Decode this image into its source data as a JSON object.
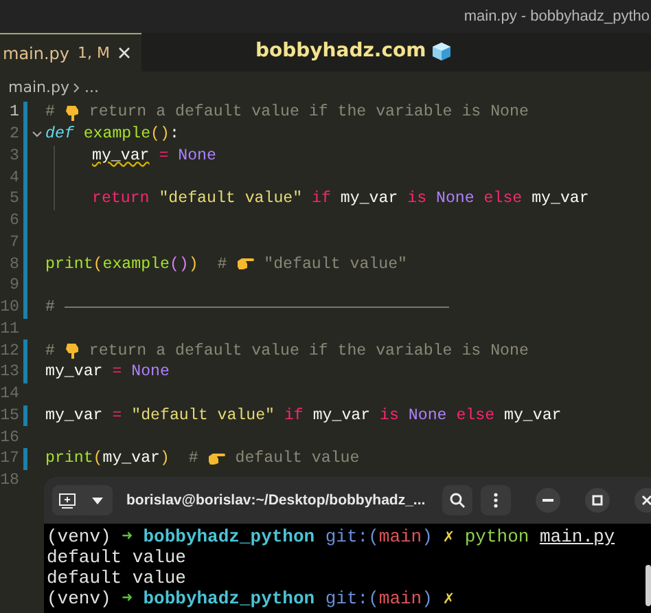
{
  "window": {
    "title": "main.py - bobbyhadz_pytho"
  },
  "tabs": [
    {
      "label": "main.py",
      "status": "1, M",
      "selected": true
    }
  ],
  "banner": {
    "text": "bobbyhadz.com"
  },
  "breadcrumb": {
    "file": "main.py",
    "rest": "..."
  },
  "editor": {
    "lines": [
      {
        "number": "1",
        "current": true,
        "modified": true,
        "tokens": [
          {
            "kind": "comment",
            "text": "# "
          },
          {
            "kind": "hand-down"
          },
          {
            "kind": "comment",
            "text": " return a default value if the variable is None"
          }
        ]
      },
      {
        "number": "2",
        "current": false,
        "modified": true,
        "foldable": true,
        "tokens": [
          {
            "kind": "storage",
            "text": "def "
          },
          {
            "kind": "func",
            "text": "example"
          },
          {
            "kind": "paren",
            "text": "()"
          },
          {
            "kind": "plain",
            "text": ":"
          }
        ]
      },
      {
        "number": "3",
        "current": false,
        "modified": true,
        "indented": true,
        "tokens": [
          {
            "kind": "plain",
            "text": "my_var",
            "warning": true
          },
          {
            "kind": "keyword",
            "text": " = "
          },
          {
            "kind": "constant",
            "text": "None"
          }
        ]
      },
      {
        "number": "4",
        "current": false,
        "modified": true,
        "indented": true
      },
      {
        "number": "5",
        "current": false,
        "modified": true,
        "indented": true,
        "tokens": [
          {
            "kind": "keyword",
            "text": "return "
          },
          {
            "kind": "string",
            "text": "\"default value\" "
          },
          {
            "kind": "keyword",
            "text": "if "
          },
          {
            "kind": "plain",
            "text": "my_var "
          },
          {
            "kind": "keyword",
            "text": "is "
          },
          {
            "kind": "constant",
            "text": "None "
          },
          {
            "kind": "keyword",
            "text": "else "
          },
          {
            "kind": "plain",
            "text": "my_var"
          }
        ]
      },
      {
        "number": "6",
        "current": false,
        "modified": true
      },
      {
        "number": "7",
        "current": false,
        "modified": true
      },
      {
        "number": "8",
        "current": false,
        "modified": true,
        "tokens": [
          {
            "kind": "func",
            "text": "print"
          },
          {
            "kind": "paren",
            "text": "("
          },
          {
            "kind": "func",
            "text": "example"
          },
          {
            "kind": "paren2",
            "text": "()"
          },
          {
            "kind": "paren",
            "text": ")  "
          },
          {
            "kind": "comment",
            "text": "# "
          },
          {
            "kind": "hand-right"
          },
          {
            "kind": "comment",
            "text": " \"default value\""
          }
        ]
      },
      {
        "number": "9",
        "current": false,
        "modified": true
      },
      {
        "number": "10",
        "current": false,
        "modified": true,
        "tokens": [
          {
            "kind": "comment",
            "text": "# "
          },
          {
            "kind": "rule"
          }
        ]
      },
      {
        "number": "11",
        "current": false,
        "modified": false
      },
      {
        "number": "12",
        "current": false,
        "modified": true,
        "tokens": [
          {
            "kind": "comment",
            "text": "# "
          },
          {
            "kind": "hand-down"
          },
          {
            "kind": "comment",
            "text": " return a default value if the variable is None"
          }
        ]
      },
      {
        "number": "13",
        "current": false,
        "modified": true,
        "tokens": [
          {
            "kind": "plain",
            "text": "my_var "
          },
          {
            "kind": "keyword",
            "text": "= "
          },
          {
            "kind": "constant",
            "text": "None"
          }
        ]
      },
      {
        "number": "14",
        "current": false,
        "modified": false
      },
      {
        "number": "15",
        "current": false,
        "modified": true,
        "tokens": [
          {
            "kind": "plain",
            "text": "my_var "
          },
          {
            "kind": "keyword",
            "text": "= "
          },
          {
            "kind": "string",
            "text": "\"default value\" "
          },
          {
            "kind": "keyword",
            "text": "if "
          },
          {
            "kind": "plain",
            "text": "my_var "
          },
          {
            "kind": "keyword",
            "text": "is "
          },
          {
            "kind": "constant",
            "text": "None "
          },
          {
            "kind": "keyword",
            "text": "else "
          },
          {
            "kind": "plain",
            "text": "my_var"
          }
        ]
      },
      {
        "number": "16",
        "current": false,
        "modified": false
      },
      {
        "number": "17",
        "current": false,
        "modified": true,
        "tokens": [
          {
            "kind": "func",
            "text": "print"
          },
          {
            "kind": "paren",
            "text": "("
          },
          {
            "kind": "plain",
            "text": "my_var"
          },
          {
            "kind": "paren",
            "text": ")  "
          },
          {
            "kind": "comment",
            "text": "# "
          },
          {
            "kind": "hand-right"
          },
          {
            "kind": "comment",
            "text": " default value"
          }
        ]
      },
      {
        "number": "18",
        "current": false,
        "modified": false
      }
    ]
  },
  "terminal": {
    "title": "borislav@borislav:~/Desktop/bobbyhadz_...",
    "lines": [
      [
        {
          "kind": "plain",
          "text": "(venv) "
        },
        {
          "kind": "arrow",
          "text": "➜ "
        },
        {
          "kind": "dir",
          "text": "bobbyhadz_python "
        },
        {
          "kind": "git",
          "text": "git:("
        },
        {
          "kind": "branch",
          "text": "main"
        },
        {
          "kind": "git",
          "text": ") "
        },
        {
          "kind": "dirty",
          "text": "✗ "
        },
        {
          "kind": "command",
          "text": "python "
        },
        {
          "kind": "path",
          "text": "main.py"
        }
      ],
      [
        {
          "kind": "plain",
          "text": "default value"
        }
      ],
      [
        {
          "kind": "plain",
          "text": "default value"
        }
      ],
      [
        {
          "kind": "plain",
          "text": "(venv) "
        },
        {
          "kind": "arrow",
          "text": "➜ "
        },
        {
          "kind": "dir",
          "text": "bobbyhadz_python "
        },
        {
          "kind": "git",
          "text": "git:("
        },
        {
          "kind": "branch",
          "text": "main"
        },
        {
          "kind": "git",
          "text": ") "
        },
        {
          "kind": "dirty",
          "text": "✗"
        }
      ]
    ]
  }
}
